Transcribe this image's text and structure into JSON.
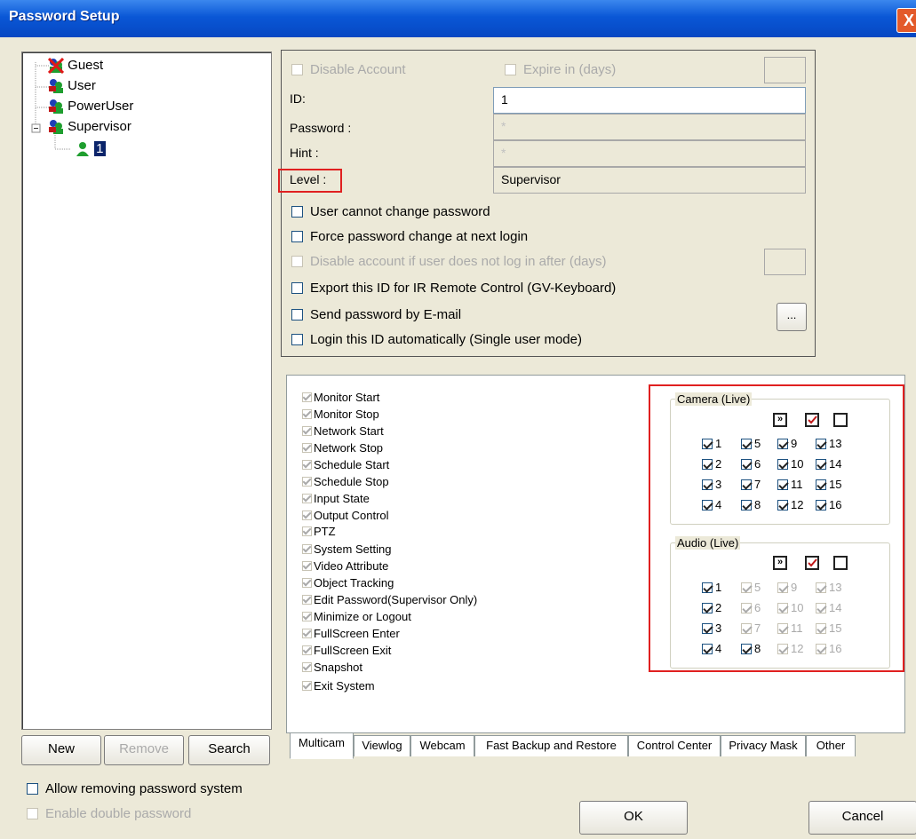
{
  "window": {
    "title": "Password Setup",
    "close_label": "X"
  },
  "tree": {
    "items": [
      {
        "label": "Guest"
      },
      {
        "label": "User"
      },
      {
        "label": "PowerUser"
      },
      {
        "label": "Supervisor"
      },
      {
        "label": "1"
      }
    ]
  },
  "left_buttons": {
    "new": "New",
    "remove": "Remove",
    "search": "Search"
  },
  "left_options": {
    "allow_removing": "Allow removing password system",
    "double_password": "Enable double password"
  },
  "account": {
    "disable_account": "Disable Account",
    "expire": "Expire in (days)",
    "id_label": "ID:",
    "id_value": "1",
    "password_label": "Password :",
    "password_value": "*",
    "hint_label": "Hint :",
    "hint_value": "*",
    "level_label": "Level :",
    "level_value": "Supervisor",
    "options": [
      "User cannot change password",
      "Force password change at next login",
      "Disable account if user does not log in after (days)",
      "Export this ID for IR Remote Control (GV-Keyboard)",
      "Send password by E-mail",
      "Login this ID automatically (Single user mode)"
    ],
    "email_button": "..."
  },
  "permissions": [
    "Monitor Start",
    "Monitor Stop",
    "Network Start",
    "Network Stop",
    "Schedule Start",
    "Schedule Stop",
    "Input State",
    "Output Control",
    "PTZ",
    "System Setting",
    "Video Attribute",
    "Object Tracking",
    "Edit Password(Supervisor Only)",
    "Minimize or Logout",
    "FullScreen Enter",
    "FullScreen Exit",
    "Snapshot",
    "Exit System"
  ],
  "camera": {
    "label": "Camera (Live)",
    "channels": [
      "1",
      "5",
      "9",
      "13",
      "2",
      "6",
      "10",
      "14",
      "3",
      "7",
      "11",
      "15",
      "4",
      "8",
      "12",
      "16"
    ]
  },
  "audio": {
    "label": "Audio (Live)",
    "channels": [
      "1",
      "5",
      "9",
      "13",
      "2",
      "6",
      "10",
      "14",
      "3",
      "7",
      "11",
      "15",
      "4",
      "8",
      "12",
      "16"
    ]
  },
  "icons": {
    "forward": "»"
  },
  "tabs": [
    "Multicam",
    "Viewlog",
    "Webcam",
    "Fast Backup and Restore",
    "Control Center",
    "Privacy Mask",
    "Other"
  ],
  "footer": {
    "ok": "OK",
    "cancel": "Cancel"
  },
  "colors": {
    "accent_red": "#e02020",
    "titlebar": "#0a57d6"
  }
}
